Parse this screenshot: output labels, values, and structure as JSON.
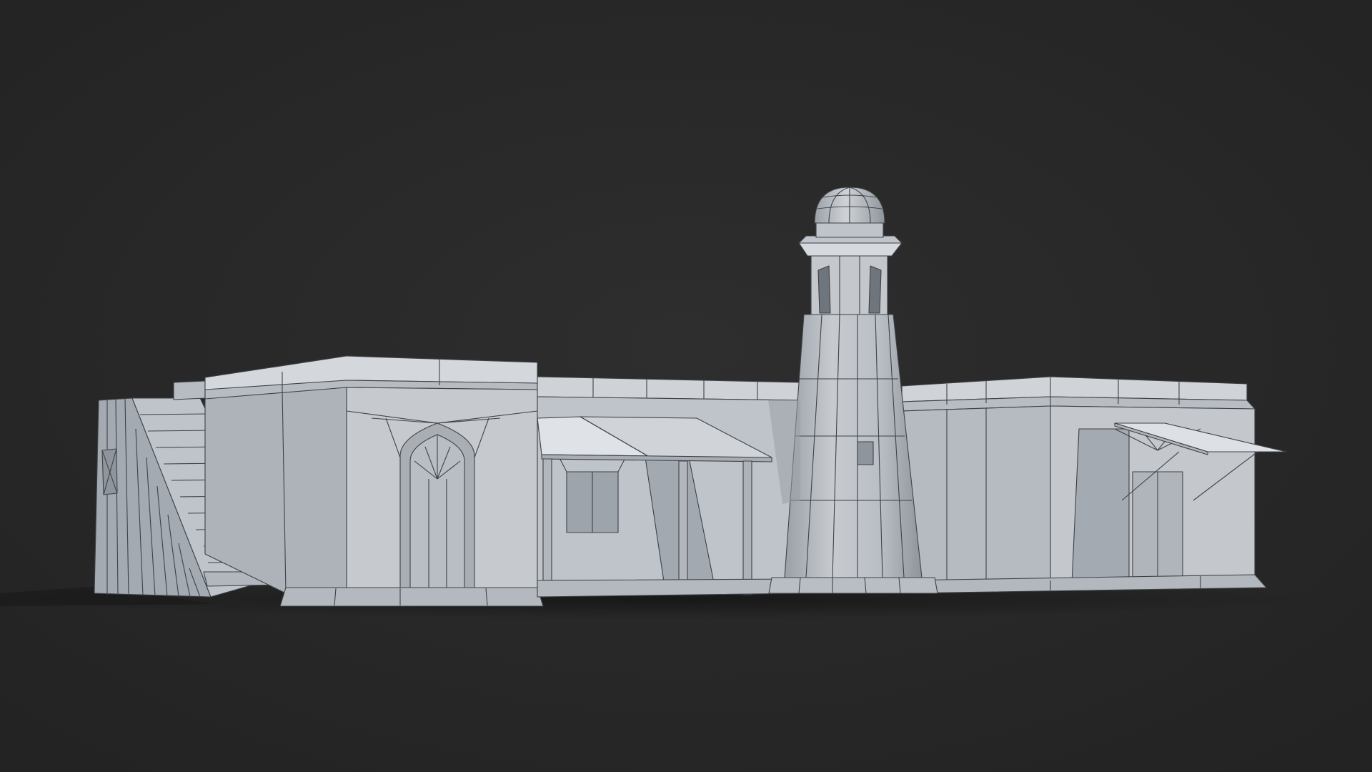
{
  "scene": {
    "subject": "clay-render-desert-mosque-model",
    "background_color": "#2a2a2a",
    "ground_color": "#262626",
    "wall_light": "#c9cdd2",
    "wall_mid": "#b3b8be",
    "wall_shadow": "#8d939a",
    "wire_color": "#3e4247",
    "icons": [
      "minaret-icon",
      "staircase-icon",
      "awning-icon",
      "arched-door-icon"
    ]
  }
}
